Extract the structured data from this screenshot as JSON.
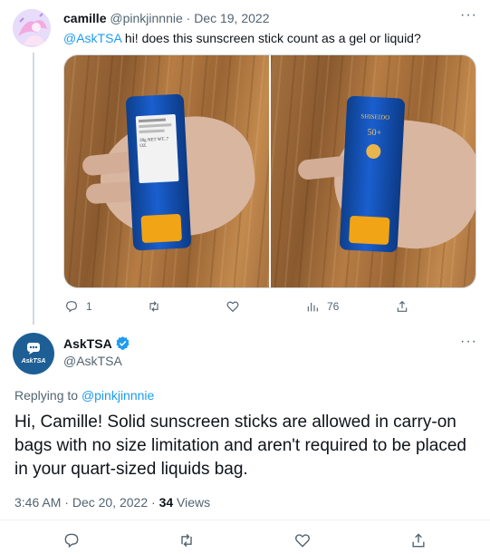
{
  "reply_tweet": {
    "display_name": "camille",
    "handle": "@pinkjinnnie",
    "separator": "·",
    "date": "Dec 19, 2022",
    "more": "···",
    "mention": "@AskTSA",
    "text": " hi! does this sunscreen stick count as a gel or liquid?",
    "photos": [
      {
        "label_lines": [
          "20g NET WT..7 OZ."
        ]
      },
      {
        "brand": "SHISEIDO",
        "spf": "50+"
      }
    ],
    "actions": {
      "reply_count": "1",
      "retweet_count": "",
      "like_count": "",
      "views_count": "76"
    }
  },
  "main_tweet": {
    "display_name": "AskTSA",
    "handle": "@AskTSA",
    "avatar_text": "AskTSA",
    "more": "···",
    "replying_prefix": "Replying to ",
    "replying_handle": "@pinkjinnnie",
    "text": "Hi, Camille! Solid sunscreen sticks are allowed in carry-on bags with no size limitation and aren't required to be placed in your quart-sized liquids bag.",
    "time": "3:46 AM",
    "separator": "·",
    "date": "Dec 20, 2022",
    "separator2": "·",
    "views_number": "34",
    "views_label": " Views"
  },
  "colors": {
    "accent": "#1d9bf0",
    "text": "#0f1419",
    "muted": "#536471",
    "verified": "#1d9bf0",
    "tsa_blue": "#1d5f95"
  },
  "icons": [
    "reply-icon",
    "retweet-icon",
    "like-icon",
    "views-icon",
    "share-icon",
    "verified-badge-icon",
    "more-icon"
  ]
}
